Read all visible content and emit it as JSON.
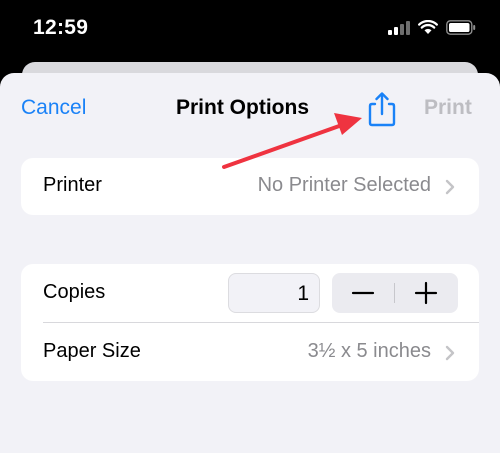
{
  "status_bar": {
    "time": "12:59",
    "icons": [
      "signal-icon",
      "wifi-icon",
      "battery-icon"
    ]
  },
  "nav": {
    "cancel_label": "Cancel",
    "title": "Print Options",
    "share_icon": "share-icon",
    "print_label": "Print"
  },
  "printer_group": {
    "label": "Printer",
    "value": "No Printer Selected"
  },
  "options_group": {
    "copies_label": "Copies",
    "copies_value": "1",
    "decrement_symbol": "minus-icon",
    "increment_symbol": "plus-icon",
    "paper_size_label": "Paper Size",
    "paper_size_value": "3½ x 5 inches"
  },
  "colors": {
    "accent": "#1a82f7",
    "annotation_arrow": "#ef3340",
    "disabled": "#bdbdc2",
    "secondary_text": "#8a8a8e",
    "background": "#f2f2f7"
  }
}
